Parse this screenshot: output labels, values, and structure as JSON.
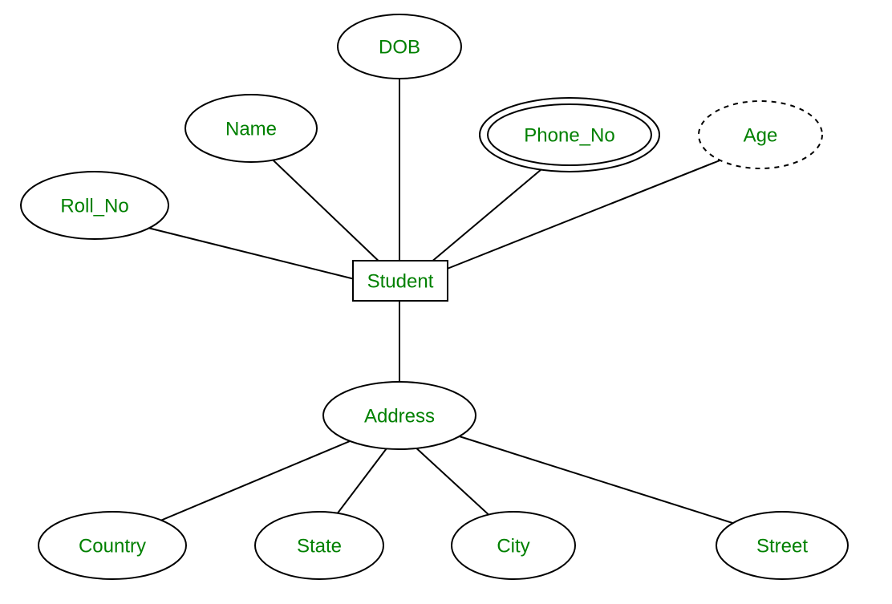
{
  "diagram": {
    "entity": {
      "label": "Student"
    },
    "attributes": {
      "dob": {
        "label": "DOB"
      },
      "name": {
        "label": "Name"
      },
      "phone_no": {
        "label": "Phone_No"
      },
      "age": {
        "label": "Age"
      },
      "roll_no": {
        "label": "Roll_No"
      },
      "address": {
        "label": "Address"
      },
      "country": {
        "label": "Country"
      },
      "state": {
        "label": "State"
      },
      "city": {
        "label": "City"
      },
      "street": {
        "label": "Street"
      }
    }
  }
}
